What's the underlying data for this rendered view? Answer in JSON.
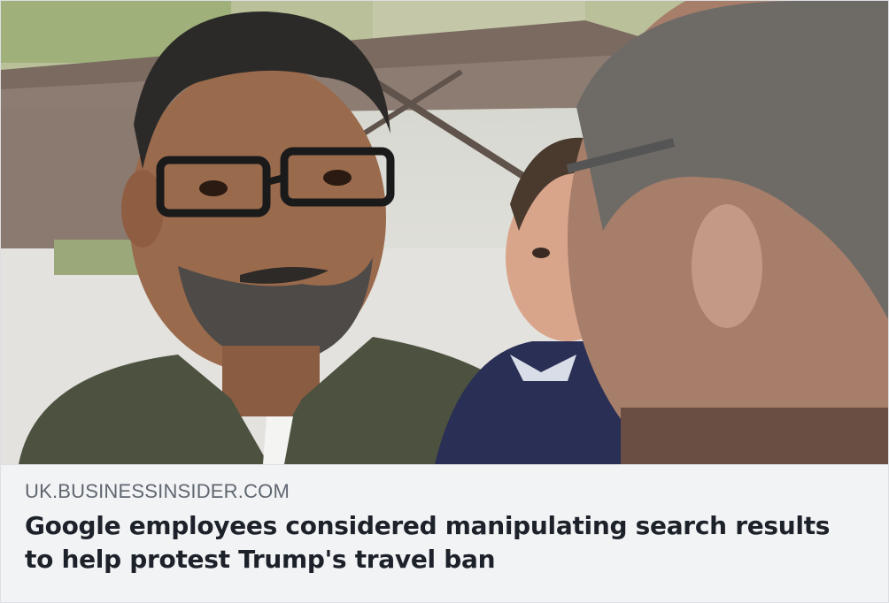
{
  "link_preview": {
    "domain": "UK.BUSINESSINSIDER.COM",
    "headline": "Google employees considered manipulating search results to help protest Trump's travel ban"
  },
  "colors": {
    "meta_background": "#f2f3f5",
    "domain_text": "#606770",
    "headline_text": "#1d2129",
    "border": "#dddfe2"
  }
}
